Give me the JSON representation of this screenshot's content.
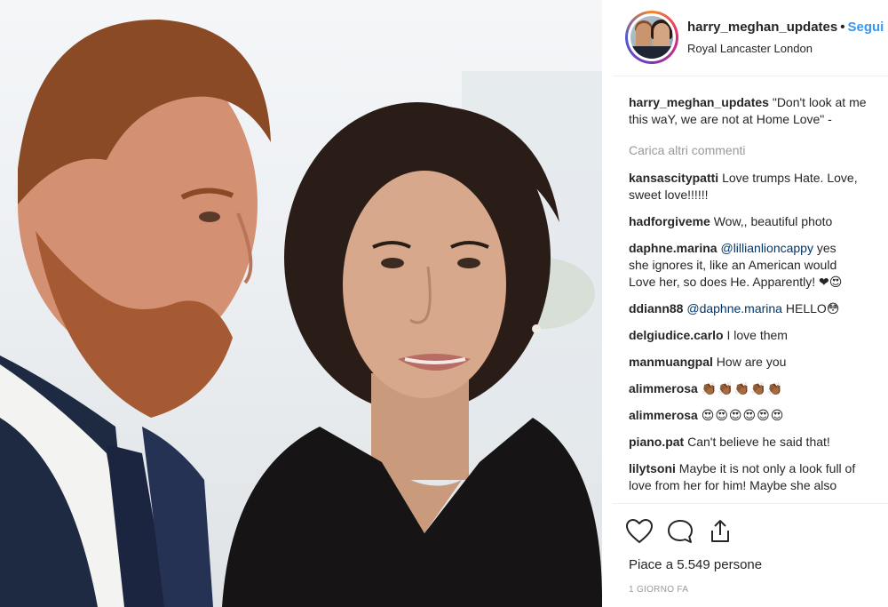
{
  "post": {
    "username": "harry_meghan_updates",
    "separator": "•",
    "follow_label": "Segui",
    "location": "Royal Lancaster London"
  },
  "caption": {
    "username": "harry_meghan_updates",
    "line1": "\"Don't look at me",
    "line2": "this waY, we are not at Home Love\" -"
  },
  "load_more_label": "Carica altri commenti",
  "comments": [
    {
      "user": "kansascitypatti",
      "line1": "Love trumps Hate. Love,",
      "line2": "sweet love!!!!!!"
    },
    {
      "user": "hadforgiveme",
      "line1": "Wow,, beautiful photo"
    },
    {
      "user": "daphne.marina",
      "mention": "@lillianlioncappy",
      "line1": "yes",
      "line2": "she ignores it, like an American would",
      "line3": "Love her, so does He. Apparently! ❤😍"
    },
    {
      "user": "ddiann88",
      "mention": "@daphne.marina",
      "line1": "HELLO😳"
    },
    {
      "user": "delgiudice.carlo",
      "line1": "I love them"
    },
    {
      "user": "manmuangpal",
      "line1": "How are you"
    },
    {
      "user": "alimmerosa",
      "line1": "👏🏾👏🏾👏🏾👏🏾👏🏾"
    },
    {
      "user": "alimmerosa",
      "line1": "😍😍😍😍😍😍"
    },
    {
      "user": "piano.pat",
      "line1": "Can't believe he said that!"
    },
    {
      "user": "lilytsoni",
      "line1": "Maybe it is not only a look full of",
      "line2": "love from her for him! Maybe she also"
    }
  ],
  "actions": {
    "like_icon": "heart-icon",
    "comment_icon": "comment-icon",
    "share_icon": "share-icon"
  },
  "likes_label": "Piace a 5.549 persone",
  "time_label": "1 GIORNO FA",
  "colors": {
    "link_blue": "#3897f0",
    "mention_blue": "#003569",
    "muted_gray": "#999999",
    "text": "#262626"
  }
}
